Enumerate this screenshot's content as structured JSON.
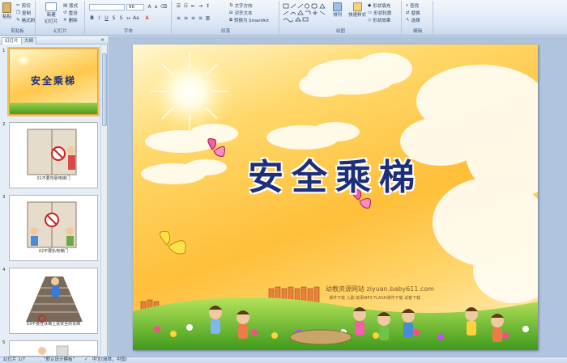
{
  "ribbon": {
    "clipboard": {
      "paste": "粘贴",
      "cut": "剪切",
      "copy": "复制",
      "format_painter": "格式刷",
      "label": "剪贴板"
    },
    "slides": {
      "new_slide": "新建",
      "new_slide_sub": "幻灯片",
      "layout": "版式",
      "reset": "重设",
      "delete": "删除",
      "label": "幻灯片"
    },
    "font": {
      "font_size": "96",
      "label": "字体"
    },
    "paragraph": {
      "text_direction": "文字方向",
      "align_text": "对齐文本",
      "smartart": "转换为 SmartArt",
      "label": "段落"
    },
    "drawing": {
      "arrange": "排列",
      "quick_styles": "快速样式",
      "shape_fill": "形状填充",
      "shape_outline": "形状轮廓",
      "shape_effects": "形状效果",
      "label": "绘图"
    },
    "editing": {
      "find": "查找",
      "replace": "替换",
      "select": "选择",
      "label": "编辑"
    }
  },
  "panel": {
    "tab_slides": "幻灯片",
    "tab_outline": "大纲",
    "close": "×",
    "thumbnails": [
      {
        "num": "1",
        "title": "安全乘梯",
        "caption": ""
      },
      {
        "num": "2",
        "caption": "01不要背靠电梯门"
      },
      {
        "num": "3",
        "caption": "02不要扒电梯门"
      },
      {
        "num": "4",
        "caption": "03不要在扶梯上扶安全的东西"
      },
      {
        "num": "5",
        "caption": ""
      }
    ]
  },
  "slide": {
    "title": "安全乘梯",
    "watermark": "幼教资源网站  ziyuan.baby611.com",
    "watermark_sub": "课件下载 儿歌 故事MP3 FLASH课件下载 试卷下载"
  },
  "statusbar": {
    "slide_pos": "幻灯片 1/7",
    "theme": "\"默认设计模板\"",
    "language": "中文(简体，中国)"
  },
  "colors": {
    "title": "#1e2f7a",
    "ribbon_bg": "#dbe6f4",
    "selection": "#f1c15f"
  }
}
